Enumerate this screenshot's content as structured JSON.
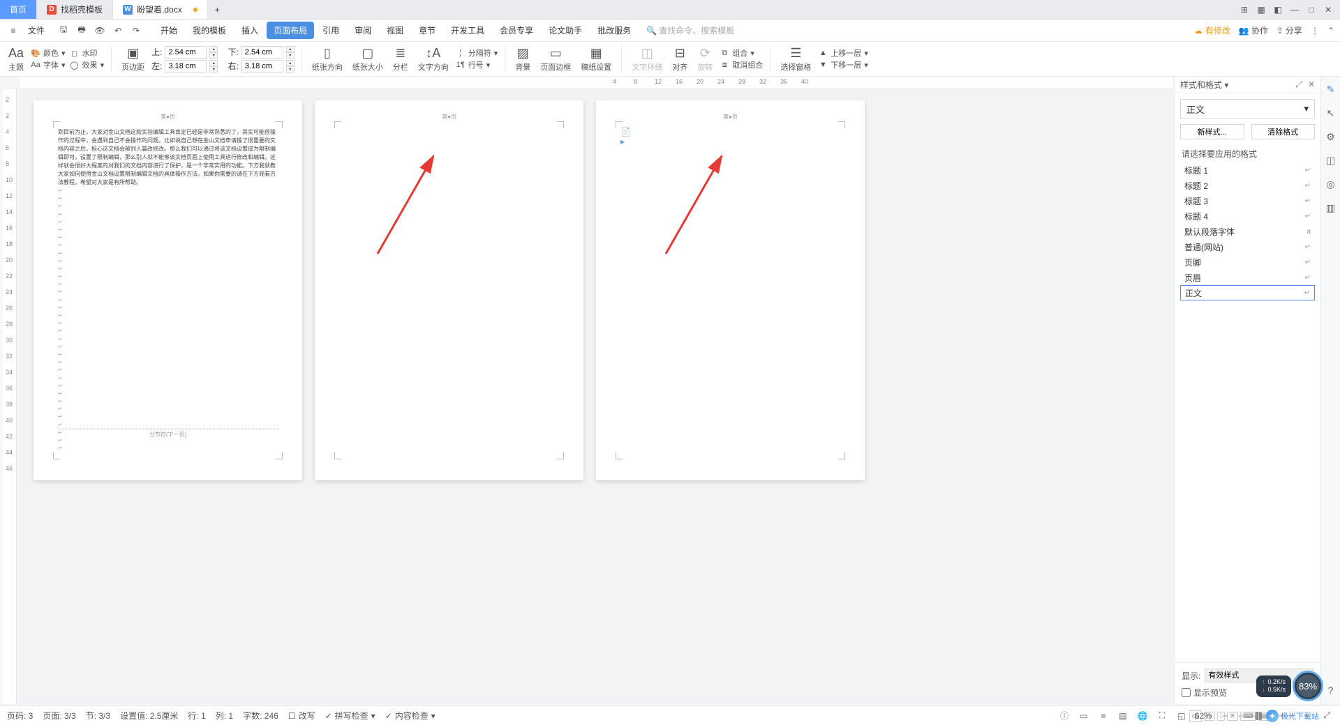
{
  "tabs": {
    "home": "首页",
    "template": "找稻壳模板",
    "doc": "盼望着.docx",
    "add": "+"
  },
  "menubar": {
    "file": "文件",
    "menus": [
      "开始",
      "我的模板",
      "插入",
      "页面布局",
      "引用",
      "审阅",
      "视图",
      "章节",
      "开发工具",
      "会员专享",
      "论文助手",
      "批改服务"
    ],
    "active_index": 3,
    "search_placeholder": "查找命令、搜索模板",
    "right": {
      "pending": "有修改",
      "collab": "协作",
      "share": "分享"
    }
  },
  "ribbon": {
    "theme": "主题",
    "color": "颜色",
    "watermark": "水印",
    "font": "字体",
    "effect": "效果",
    "margins": "页边距",
    "top_label": "上:",
    "top_val": "2.54 cm",
    "bottom_label": "下:",
    "bottom_val": "2.54 cm",
    "left_label": "左:",
    "left_val": "3.18 cm",
    "right_label": "右:",
    "right_val": "3.18 cm",
    "orient": "纸张方向",
    "size": "纸张大小",
    "columns": "分栏",
    "textdir": "文字方向",
    "breaks": "分隔符",
    "lineno": "行号",
    "bg": "背景",
    "border": "页面边框",
    "paper": "稿纸设置",
    "wrap": "文字环绕",
    "align": "对齐",
    "rotate": "旋转",
    "group": "组合",
    "ungroup": "取消组合",
    "selpane": "选择窗格",
    "forward": "上移一层",
    "backward": "下移一层"
  },
  "ruler_marks": [
    " ",
    "4",
    "8",
    "12",
    "16",
    "20",
    "24",
    "28",
    "32",
    "36",
    "40"
  ],
  "vruler_marks": [
    "2",
    "2",
    "4",
    "6",
    "8",
    "10",
    "12",
    "14",
    "16",
    "18",
    "20",
    "22",
    "24",
    "26",
    "28",
    "30",
    "32",
    "34",
    "36",
    "38",
    "40",
    "42",
    "44",
    "46"
  ],
  "pages": {
    "header_text": "第●页",
    "body_text": "到目前为止，大家对金山文档这款实验编辑工具肯定已经是非常熟悉的了。其实可能很操作的过程中，会遇到自己不会操作的问题。比如说自己想在金山文档申请操了很重要的文档内容之后，担心这文档会被别人篡改修改。那么我们可以通过将该文档设置成为限制编辑即可。设置了限制编辑，那么别人就不能够该文档页面上使用工具进行修改和编辑。这样就会很好大程度的对我们的文档内容进行了保护，是一个非常实用的功能。下方我就教大家如何使用金山文档设置限制编辑文档的具体操作方法。如果你需要的请在下方观看方法教程。希望对大家是有所帮助。",
    "footer_text": "分节符(下一页)"
  },
  "panel": {
    "title": "样式和格式",
    "current": "正文",
    "new_btn": "新样式...",
    "clear_btn": "清除格式",
    "caption": "请选择要应用的格式",
    "styles": [
      {
        "name": "标题 1",
        "mark": "↵"
      },
      {
        "name": "标题 2",
        "mark": "↵"
      },
      {
        "name": "标题 3",
        "mark": "↵"
      },
      {
        "name": "标题 4",
        "mark": "↵"
      },
      {
        "name": "默认段落字体",
        "mark": "a"
      },
      {
        "name": "普通(网站)",
        "mark": "↵"
      },
      {
        "name": "页脚",
        "mark": "↵"
      },
      {
        "name": "页眉",
        "mark": "↵"
      },
      {
        "name": "正文",
        "mark": "↵",
        "selected": true
      }
    ],
    "show_label": "显示:",
    "show_value": "有效样式",
    "preview_label": "显示预览"
  },
  "status": {
    "pageno": "页码: 3",
    "page": "页面: 3/3",
    "section": "节: 3/3",
    "setval": "设置值: 2.5厘米",
    "line": "行: 1",
    "col": "列: 1",
    "words": "字数: 246",
    "overwrite": "改写",
    "spell": "拼写检查",
    "content": "内容检查",
    "zoom": "62%"
  },
  "overlay": {
    "up": "0.2K/s",
    "dn": "0.5K/s",
    "pct": "83%",
    "brand": "极光下载站"
  }
}
